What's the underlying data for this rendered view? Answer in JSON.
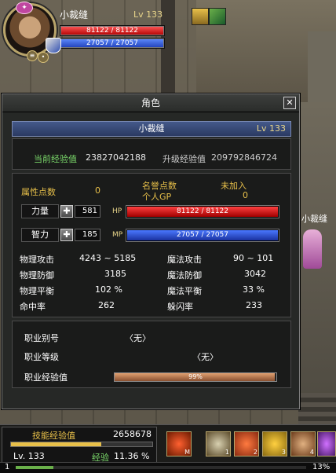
{
  "player": {
    "name": "小裁缝",
    "level": "Lv 133",
    "hp_text": "81122 / 81122",
    "mp_text": "27057 / 27057",
    "hp_ratio": 1.0,
    "mp_ratio": 1.0
  },
  "window": {
    "title": "角色",
    "close_label": "✕",
    "name": "小裁缝",
    "level": "Lv 133",
    "current_exp_label": "当前经验值",
    "current_exp_value": "23827042188",
    "next_exp_label": "升级经验值",
    "next_exp_value": "209792846724",
    "attr_points_label": "属性点数",
    "attr_points_value": "0",
    "honor_label": "名誉点数",
    "guild_label": "未加入",
    "gp_label": "个人GP",
    "gp_value": "0",
    "strength_label": "力量",
    "strength_value": "581",
    "intelligence_label": "智力",
    "intelligence_value": "185",
    "plus_label": "✚",
    "hp_tag": "HP",
    "mp_tag": "MP",
    "hp_text": "81122 / 81122",
    "mp_text": "27057 / 27057",
    "stats": [
      {
        "label": "物理攻击",
        "value": "4243 ~ 5185"
      },
      {
        "label": "魔法攻击",
        "value": "90 ~ 101"
      },
      {
        "label": "物理防御",
        "value": "3185"
      },
      {
        "label": "魔法防御",
        "value": "3042"
      },
      {
        "label": "物理平衡",
        "value": "102 %"
      },
      {
        "label": "魔法平衡",
        "value": "33 %"
      },
      {
        "label": "命中率",
        "value": "262"
      },
      {
        "label": "躲闪率",
        "value": "233"
      }
    ],
    "job_alias_label": "职业别号",
    "job_alias_value": "〈无〉",
    "job_level_label": "职业等级",
    "job_level_value": "〈无〉",
    "job_exp_label": "职业经验值",
    "job_exp_text": "99%",
    "job_exp_ratio": 0.99
  },
  "hud": {
    "skill_exp_label": "技能经验值",
    "skill_exp_value": "2658678",
    "skill_exp_ratio": 0.64,
    "level": "Lv. 133",
    "exp_label": "经验",
    "exp_value": "11.36 %",
    "slots": [
      {
        "num": "M",
        "icon": "fire-fist-icon"
      },
      {
        "num": "1",
        "icon": "helmet-icon"
      },
      {
        "num": "2",
        "icon": "rage-face-icon"
      },
      {
        "num": "3",
        "icon": "gold-mask-icon"
      },
      {
        "num": "4",
        "icon": "flame-helm-icon"
      },
      {
        "num": "",
        "icon": "purple-orb-icon"
      }
    ],
    "bottom_num": "1",
    "bottom_pct": "13%",
    "bottom_ratio": 0.13
  },
  "npc": {
    "name": "小裁缝"
  },
  "colors": {
    "hp": "#d10000",
    "mp": "#2448d0",
    "accent_gold": "#e8c04a",
    "accent_green": "#7ad86a"
  }
}
